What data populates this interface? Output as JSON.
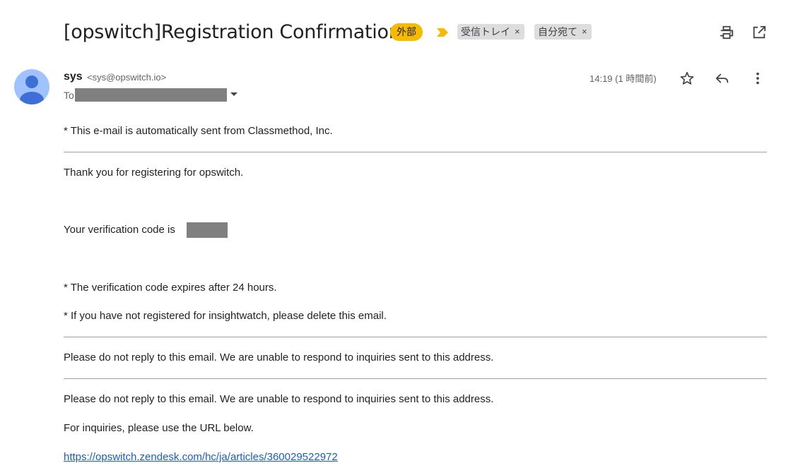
{
  "subject": "[opswitch]Registration Confirmation",
  "badges": {
    "external": "外部"
  },
  "labels": [
    {
      "name": "受信トレイ",
      "remove": "×"
    },
    {
      "name": "自分宛て",
      "remove": "×"
    }
  ],
  "sender": {
    "name": "sys",
    "email": "<sys@opswitch.io>"
  },
  "recipient": {
    "prefix": "To"
  },
  "timestamp": "14:19 (1 時間前)",
  "body": {
    "line1": "* This e-mail is automatically sent from Classmethod, Inc.",
    "line2": "Thank you for registering for opswitch.",
    "line3": "Your verification code is",
    "line4": "* The verification code expires after 24 hours.",
    "line5": "* If you have not registered for insightwatch, please delete this email.",
    "line6": "Please do not reply to this email. We are unable to respond to inquiries sent to this address.",
    "line7": "Please do not reply to this email. We are unable to respond to inquiries sent to this address.",
    "line8": "For inquiries, please use the URL below.",
    "link": "https://opswitch.zendesk.com/hc/ja/articles/360029522972"
  },
  "colors": {
    "external_badge": "#f6bb00",
    "importance_marker": "#f6bb00",
    "label_chip": "#dddddd",
    "avatar_bg": "#a0c3ff",
    "avatar_fg": "#3d6fd6",
    "link": "#1a5cc8",
    "redaction": "#808080"
  }
}
